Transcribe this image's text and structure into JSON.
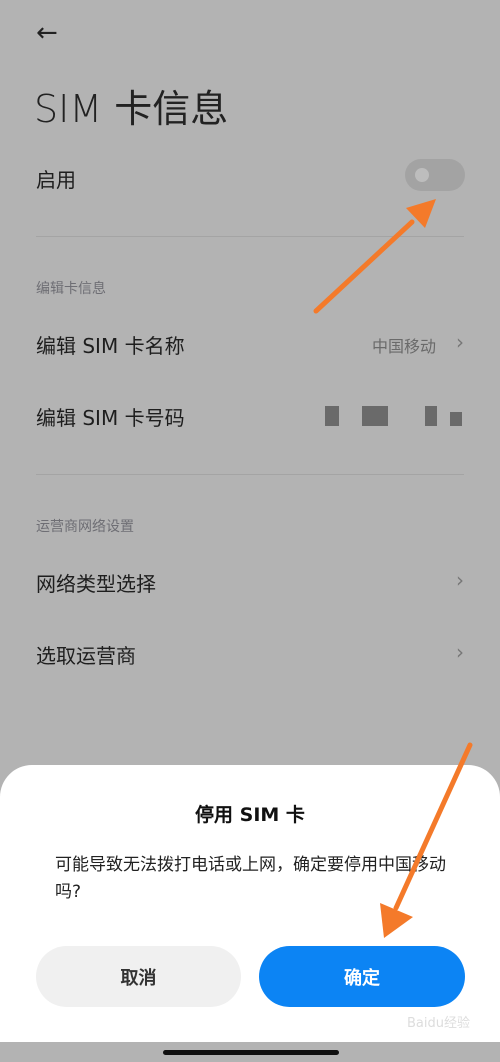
{
  "header": {
    "back_icon": "arrow-left-icon",
    "title": "SIM 卡信息"
  },
  "enable": {
    "label": "启用",
    "toggle_on": false
  },
  "sections": [
    {
      "title": "编辑卡信息",
      "items": [
        {
          "label": "编辑 SIM 卡名称",
          "value": "中国移动"
        },
        {
          "label": "编辑 SIM 卡号码",
          "value_masked": true
        }
      ]
    },
    {
      "title": "运营商网络设置",
      "items": [
        {
          "label": "网络类型选择"
        },
        {
          "label": "选取运营商"
        }
      ]
    }
  ],
  "dialog": {
    "title": "停用 SIM 卡",
    "message": "可能导致无法拨打电话或上网，确定要停用中国移动吗?",
    "cancel": "取消",
    "confirm": "确定"
  },
  "watermark": "Baidu经验 jingyan.baidu.com",
  "colors": {
    "accent": "#0c84f4",
    "annotation_arrow": "#f47a2a"
  }
}
